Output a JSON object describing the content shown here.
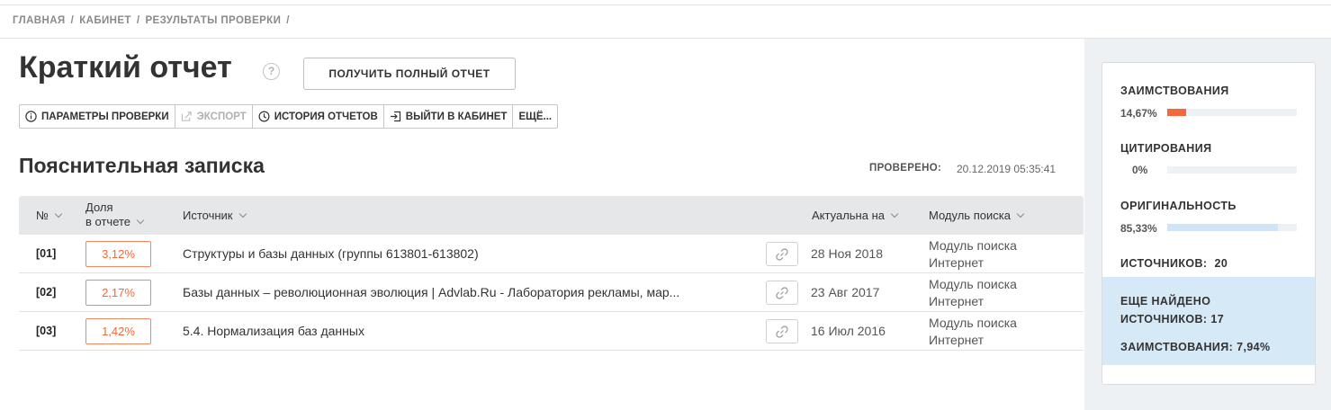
{
  "breadcrumb": [
    {
      "label": "ГЛАВНАЯ"
    },
    {
      "label": "КАБИНЕТ"
    },
    {
      "label": "РЕЗУЛЬТАТЫ ПРОВЕРКИ"
    }
  ],
  "breadcrumb_separator": "/",
  "page": {
    "title": "Краткий отчет",
    "help_icon": "?",
    "full_report_button": "ПОЛУЧИТЬ ПОЛНЫЙ ОТЧЕТ"
  },
  "toolbar": {
    "params": "ПАРАМЕТРЫ ПРОВЕРКИ",
    "export": "ЭКСПОРТ",
    "history": "ИСТОРИЯ ОТЧЕТОВ",
    "exit": "ВЫЙТИ В КАБИНЕТ",
    "more": "ЕЩЁ..."
  },
  "document": {
    "title": "Пояснительная записка",
    "checked_label": "ПРОВЕРЕНО:",
    "checked_date": "20.12.2019 05:35:41"
  },
  "table": {
    "headers": {
      "num": "№",
      "share_line1": "Доля",
      "share_line2": "в отчете",
      "source": "Источник",
      "actual": "Актуальна на",
      "module": "Модуль поиска"
    },
    "rows": [
      {
        "num": "[01]",
        "share": "3,12%",
        "source": "Структуры и базы данных (группы 613801-613802)",
        "date": "28 Ноя 2018",
        "module": "Модуль поиска Интернет"
      },
      {
        "num": "[02]",
        "share": "2,17%",
        "source": "Базы данных – революционная эволюция | Advlab.Ru - Лаборатория рекламы, мар...",
        "date": "23 Авг 2017",
        "module": "Модуль поиска Интернет"
      },
      {
        "num": "[03]",
        "share": "1,42%",
        "source": "5.4. Нормализация баз данных",
        "date": "16 Июл 2016",
        "module": "Модуль поиска Интернет"
      }
    ]
  },
  "stats": {
    "borrowings_label": "ЗАИМСТВОВАНИЯ",
    "borrowings_value": "14,67%",
    "borrowings_fraction": 0.1467,
    "citations_label": "ЦИТИРОВАНИЯ",
    "citations_value": "0%",
    "citations_fraction": 0,
    "originality_label": "ОРИГИНАЛЬНОСТЬ",
    "originality_value": "85,33%",
    "originality_fraction": 0.8533,
    "sources_label": "ИСТОЧНИКОВ:",
    "sources_count": "20",
    "found_line1": "ЕЩЕ НАЙДЕНО",
    "found_line2": "ИСТОЧНИКОВ: 17",
    "found_line3": "ЗАИМСТВОВАНИЯ: 7,94%"
  },
  "colors": {
    "borrowings_bar": "#f4683a",
    "originality_bar": "#cfe4f6",
    "share_badge": "#ee6a3b",
    "found_box_bg": "#d6e9f7"
  }
}
